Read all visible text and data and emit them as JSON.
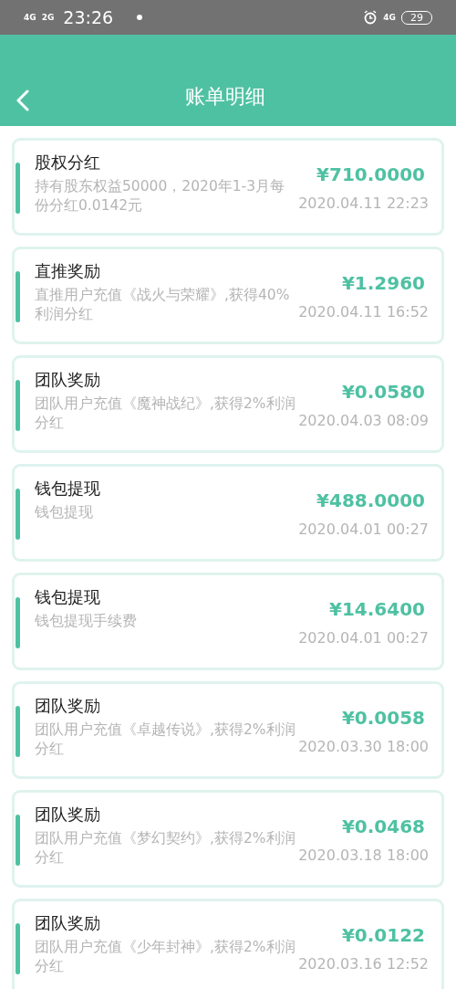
{
  "status_bar": {
    "signal_1": "4G",
    "signal_2": "2G",
    "time": "23:26",
    "network": "4G",
    "battery": "29"
  },
  "header": {
    "title": "账单明细"
  },
  "records": [
    {
      "title": "股权分红",
      "description": "持有股东权益50000，2020年1-3月每份分红0.0142元",
      "amount": "¥710.0000",
      "time": "2020.04.11 22:23"
    },
    {
      "title": "直推奖励",
      "description": "直推用户充值《战火与荣耀》,获得40%利润分红",
      "amount": "¥1.2960",
      "time": "2020.04.11 16:52"
    },
    {
      "title": "团队奖励",
      "description": "团队用户充值《魔神战纪》,获得2%利润分红",
      "amount": "¥0.0580",
      "time": "2020.04.03 08:09"
    },
    {
      "title": "钱包提现",
      "description": "钱包提现",
      "amount": "¥488.0000",
      "time": "2020.04.01 00:27"
    },
    {
      "title": "钱包提现",
      "description": "钱包提现手续费",
      "amount": "¥14.6400",
      "time": "2020.04.01 00:27"
    },
    {
      "title": "团队奖励",
      "description": "团队用户充值《卓越传说》,获得2%利润分红",
      "amount": "¥0.0058",
      "time": "2020.03.30 18:00"
    },
    {
      "title": "团队奖励",
      "description": "团队用户充值《梦幻契约》,获得2%利润分红",
      "amount": "¥0.0468",
      "time": "2020.03.18 18:00"
    },
    {
      "title": "团队奖励",
      "description": "团队用户充值《少年封神》,获得2%利润分红",
      "amount": "¥0.0122",
      "time": "2020.03.16 12:52"
    }
  ]
}
